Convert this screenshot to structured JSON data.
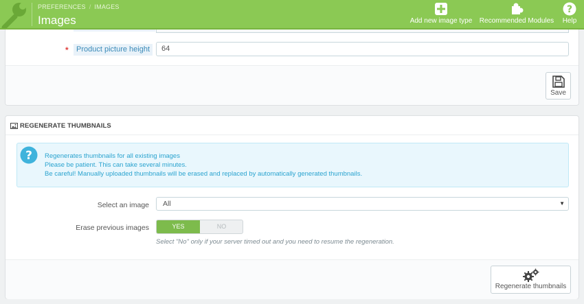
{
  "header": {
    "breadcrumb": [
      "PREFERENCES",
      "IMAGES"
    ],
    "breadcrumb_separator": "/",
    "title": "Images",
    "toolbar": {
      "add_label": "Add new image type",
      "modules_label": "Recommended Modules",
      "help_label": "Help"
    },
    "icons": [
      "wrench-icon",
      "plus-square-icon",
      "puzzle-icon",
      "question-circle-icon"
    ],
    "colors": {
      "header_bg": "#8bc954"
    }
  },
  "image_settings": {
    "height_label": "Product picture height",
    "height_required_marker": "*",
    "height_value": "64",
    "save_label": "Save",
    "save_icon": "floppy-disk-icon"
  },
  "regenerate": {
    "heading": "REGENERATE THUMBNAILS",
    "heading_icon": "picture-icon",
    "info": {
      "icon": "question-circle-icon",
      "lines": [
        "Regenerates thumbnails for all existing images",
        "Please be patient. This can take several minutes.",
        "Be careful! Manually uploaded thumbnails will be erased and replaced by automatically generated thumbnails."
      ]
    },
    "select_label": "Select an image",
    "select_value": "All",
    "erase_label": "Erase previous images",
    "erase_yes": "YES",
    "erase_no": "NO",
    "erase_selected": "YES",
    "help_text": "Select \"No\" only if your server timed out and you need to resume the regeneration.",
    "button_label": "Regenerate thumbnails",
    "button_icon": "cogs-icon",
    "colors": {
      "info_text": "#2aa3cf",
      "switch_on": "#7dbb4c"
    }
  }
}
